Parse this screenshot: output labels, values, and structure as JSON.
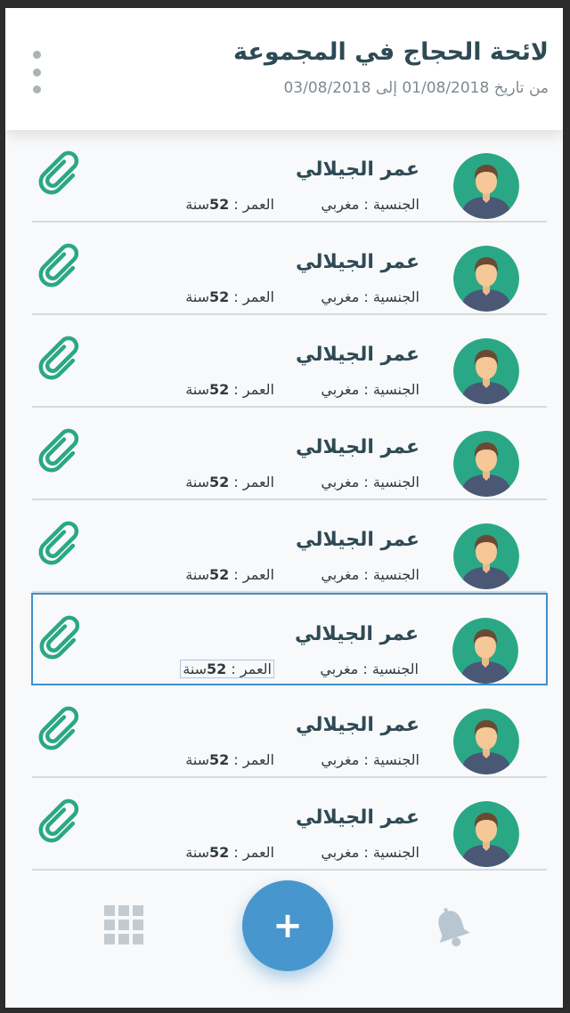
{
  "header": {
    "title": "لائحة الحجاج في المجموعة",
    "subtitle": "من تاريخ 01/08/2018 إلى 03/08/2018"
  },
  "pilgrims": [
    {
      "name": "عمر الجيلالي",
      "nationality": "الجنسية : مغربي",
      "age_label": "العمر : ",
      "age_value": "52",
      "age_unit": "سنة"
    },
    {
      "name": "عمر الجيلالي",
      "nationality": "الجنسية : مغربي",
      "age_label": "العمر : ",
      "age_value": "52",
      "age_unit": "سنة"
    },
    {
      "name": "عمر الجيلالي",
      "nationality": "الجنسية : مغربي",
      "age_label": "العمر : ",
      "age_value": "52",
      "age_unit": "سنة"
    },
    {
      "name": "عمر الجيلالي",
      "nationality": "الجنسية : مغربي",
      "age_label": "العمر : ",
      "age_value": "52",
      "age_unit": "سنة"
    },
    {
      "name": "عمر الجيلالي",
      "nationality": "الجنسية : مغربي",
      "age_label": "العمر : ",
      "age_value": "52",
      "age_unit": "سنة"
    },
    {
      "name": "عمر الجيلالي",
      "nationality": "الجنسية : مغربي",
      "age_label": "العمر : ",
      "age_value": "52",
      "age_unit": "سنة"
    },
    {
      "name": "عمر الجيلالي",
      "nationality": "الجنسية : مغربي",
      "age_label": "العمر : ",
      "age_value": "52",
      "age_unit": "سنة"
    },
    {
      "name": "عمر الجيلالي",
      "nationality": "الجنسية : مغربي",
      "age_label": "العمر : ",
      "age_value": "52",
      "age_unit": "سنة"
    }
  ],
  "selected_index": 5,
  "bottom_bar": {
    "fab_label": "+",
    "left_icon": "grid-icon",
    "right_icon": "bell-icon"
  },
  "colors": {
    "accent": "#4896ce",
    "avatar_bg": "#2aa885",
    "clip": "#2aa885",
    "title": "#2e4a55"
  },
  "icons": {
    "row_avatar": "user-avatar-icon",
    "row_action": "paperclip-icon",
    "menu": "more-vertical-icon"
  }
}
